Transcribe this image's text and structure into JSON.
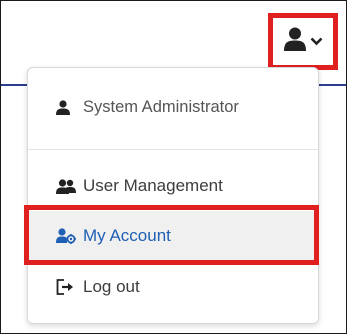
{
  "header": {
    "user_icon": "user-icon",
    "chevron_icon": "chevron-down-icon"
  },
  "menu": {
    "user_name": "System Administrator",
    "items": [
      {
        "label": "User Management",
        "icon": "users-icon"
      },
      {
        "label": "My Account",
        "icon": "user-gear-icon"
      },
      {
        "label": "Log out",
        "icon": "sign-out-icon"
      }
    ]
  },
  "colors": {
    "highlight": "#e01f1f",
    "link": "#1f5fb4",
    "header_rule": "#2b3f8f"
  }
}
